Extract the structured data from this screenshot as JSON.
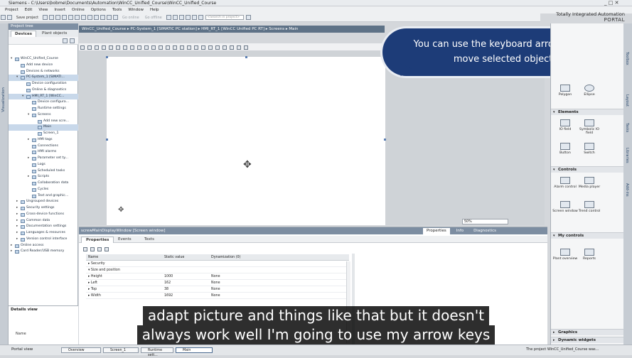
{
  "window": {
    "title": "Siemens - C:\\Users\\bobme\\Documents\\Automation\\WinCC_Unified_Course\\WinCC_Unified_Course",
    "controls": "_ □ ✕"
  },
  "brand": {
    "line1": "Totally Integrated Automation",
    "line2": "PORTAL"
  },
  "menu": [
    "Project",
    "Edit",
    "View",
    "Insert",
    "Online",
    "Options",
    "Tools",
    "Window",
    "Help"
  ],
  "toolbar": {
    "save": "Save project",
    "go_online": "Go online",
    "go_offline": "Go offline",
    "search_placeholder": "<Search in project>"
  },
  "left_strip": {
    "label": "Visualization"
  },
  "project_tree": {
    "title": "Project tree",
    "tabs": [
      "Devices",
      "Plant objects"
    ],
    "items": [
      {
        "label": "WinCC_Unified_Course",
        "level": 0,
        "expander": "▾",
        "selected": false
      },
      {
        "label": "Add new device",
        "level": 1,
        "expander": "",
        "selected": false
      },
      {
        "label": "Devices & networks",
        "level": 1,
        "expander": "",
        "selected": false
      },
      {
        "label": "PC-System_1 [SIMATI...",
        "level": 1,
        "expander": "▾",
        "selected": true
      },
      {
        "label": "Device configuration",
        "level": 2,
        "expander": "",
        "selected": false
      },
      {
        "label": "Online & diagnostics",
        "level": 2,
        "expander": "",
        "selected": false
      },
      {
        "label": "HMI_RT_1 [WinCC...",
        "level": 2,
        "expander": "▾",
        "selected": true
      },
      {
        "label": "Device configura...",
        "level": 3,
        "expander": "",
        "selected": false
      },
      {
        "label": "Runtime settings",
        "level": 3,
        "expander": "",
        "selected": false
      },
      {
        "label": "Screens",
        "level": 3,
        "expander": "▾",
        "selected": false
      },
      {
        "label": "Add new scre...",
        "level": 4,
        "expander": "",
        "selected": false
      },
      {
        "label": "Main",
        "level": 4,
        "expander": "",
        "selected": true
      },
      {
        "label": "Screen_1",
        "level": 4,
        "expander": "",
        "selected": false
      },
      {
        "label": "HMI tags",
        "level": 3,
        "expander": "▸",
        "selected": false
      },
      {
        "label": "Connections",
        "level": 3,
        "expander": "",
        "selected": false
      },
      {
        "label": "HMI alarms",
        "level": 3,
        "expander": "",
        "selected": false
      },
      {
        "label": "Parameter set ty...",
        "level": 3,
        "expander": "▸",
        "selected": false
      },
      {
        "label": "Logs",
        "level": 3,
        "expander": "",
        "selected": false
      },
      {
        "label": "Scheduled tasks",
        "level": 3,
        "expander": "",
        "selected": false
      },
      {
        "label": "Scripts",
        "level": 3,
        "expander": "▸",
        "selected": false
      },
      {
        "label": "Collaboration data",
        "level": 3,
        "expander": "",
        "selected": false
      },
      {
        "label": "Cycles",
        "level": 3,
        "expander": "",
        "selected": false
      },
      {
        "label": "Text and graphic...",
        "level": 3,
        "expander": "",
        "selected": false
      },
      {
        "label": "Ungrouped devices",
        "level": 1,
        "expander": "▸",
        "selected": false
      },
      {
        "label": "Security settings",
        "level": 1,
        "expander": "▸",
        "selected": false
      },
      {
        "label": "Cross-device functions",
        "level": 1,
        "expander": "▸",
        "selected": false
      },
      {
        "label": "Common data",
        "level": 1,
        "expander": "▸",
        "selected": false
      },
      {
        "label": "Documentation settings",
        "level": 1,
        "expander": "▸",
        "selected": false
      },
      {
        "label": "Languages & resources",
        "level": 1,
        "expander": "▸",
        "selected": false
      },
      {
        "label": "Version control interface",
        "level": 1,
        "expander": "▸",
        "selected": false
      },
      {
        "label": "Online access",
        "level": 0,
        "expander": "▸",
        "selected": false
      },
      {
        "label": "Card Reader/USB memory",
        "level": 0,
        "expander": "▸",
        "selected": false
      }
    ]
  },
  "details_view": {
    "title": "Details view",
    "name_col": "Name"
  },
  "breadcrumb": "WinCC_Unified_Course  ▸  PC-System_1 [SIMATIC PC station]  ▸  HMI_RT_1 [WinCC Unified PC RT]  ▸  Screens  ▸  Main",
  "editor": {
    "zoom": "50%"
  },
  "callout": {
    "line1": "You can use the keyboard arrow keys to",
    "line2": "move  selected objects"
  },
  "inspector": {
    "title": "screwMainDisplayWindow [Screen window]",
    "right_tabs": [
      "Properties",
      "Info",
      "Diagnostics"
    ],
    "tabs": [
      "Properties",
      "Events",
      "Texts"
    ],
    "columns": [
      "Name",
      "Static value",
      "Dynamization (0)"
    ],
    "rows": [
      {
        "name": "▸  Security",
        "value": "",
        "dyn": ""
      },
      {
        "name": "▾  Size and position",
        "value": "",
        "dyn": ""
      },
      {
        "name": "    ▸  Height",
        "value": "1000",
        "dyn": "None"
      },
      {
        "name": "    ▸  Left",
        "value": "162",
        "dyn": "None"
      },
      {
        "name": "    ▸  Top",
        "value": "38",
        "dyn": "None"
      },
      {
        "name": "    ▸  Width",
        "value": "1692",
        "dyn": "None"
      }
    ]
  },
  "toolbox": {
    "basic": [
      {
        "label": "Polygon"
      },
      {
        "label": "Ellipse"
      }
    ],
    "elements_title": "Elements",
    "elements": [
      {
        "label": "IO field"
      },
      {
        "label": "Symbolic IO field"
      },
      {
        "label": "Button"
      },
      {
        "label": "Switch"
      }
    ],
    "controls_title": "Controls",
    "controls": [
      {
        "label": "Alarm control"
      },
      {
        "label": "Media player"
      },
      {
        "label": "Screen window"
      },
      {
        "label": "Trend control"
      }
    ],
    "mycontrols_title": "My controls",
    "mycontrols": [
      {
        "label": "Plant overview"
      },
      {
        "label": "Reports"
      }
    ],
    "graphics_title": "Graphics",
    "dynamic_title": "Dynamic widgets"
  },
  "side_tabs": [
    "Toolbox",
    "Layout",
    "Tasks",
    "Libraries",
    "Add-ins"
  ],
  "taskbar": {
    "portal": "Portal view",
    "tasks": [
      "Overview",
      "Screen_1",
      "Runtime sett...",
      "Main"
    ],
    "status": "The project WinCC_Unified_Course was..."
  },
  "subtitles": [
    "adapt picture and things like that but it doesn't",
    "always work well I'm going to use my arrow keys"
  ]
}
